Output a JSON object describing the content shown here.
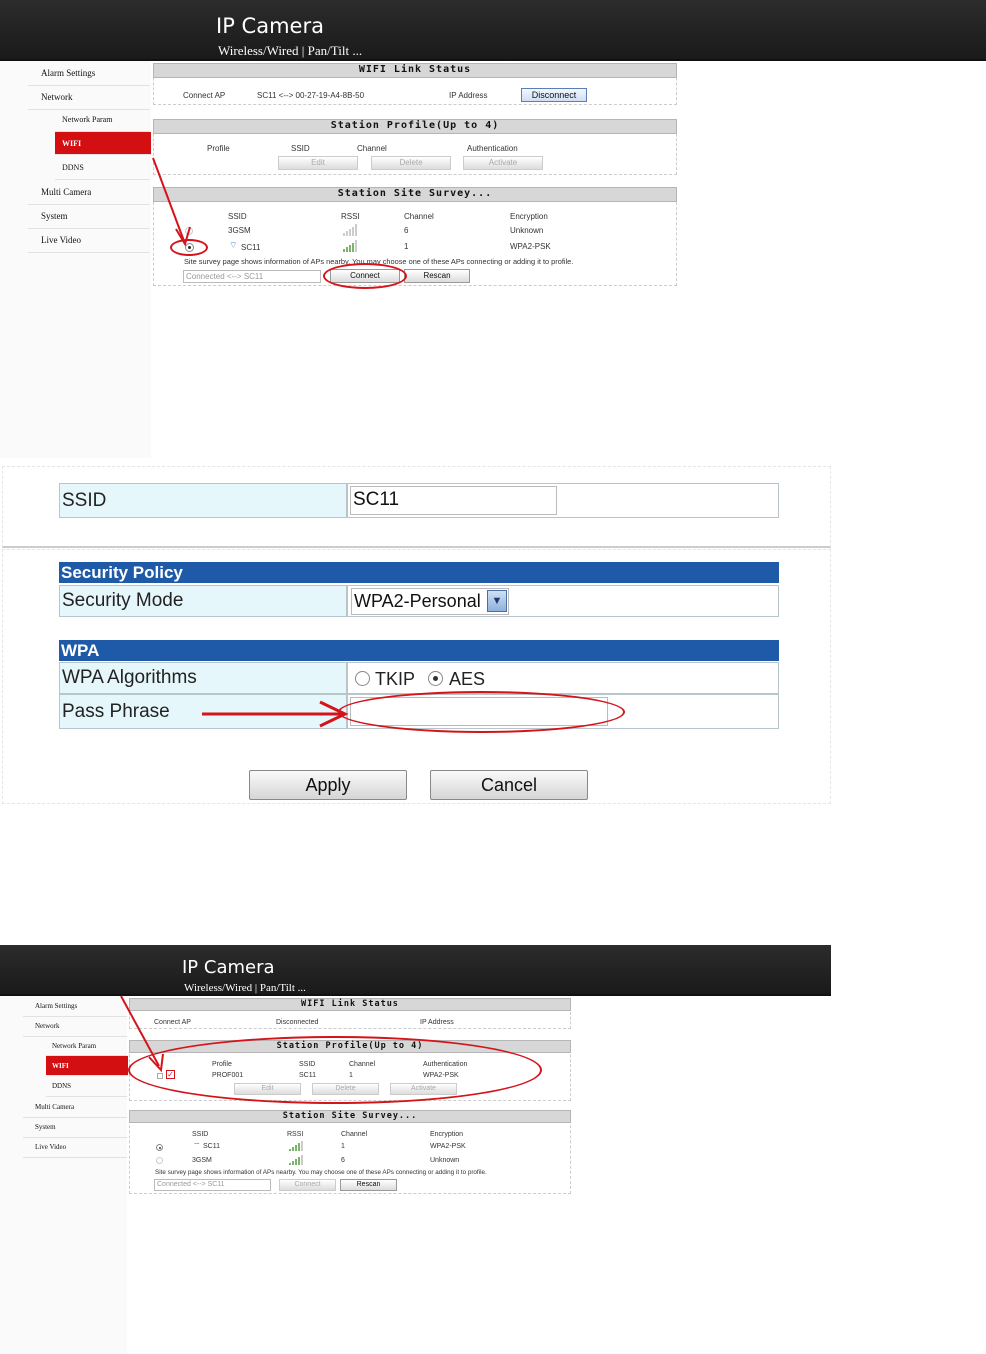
{
  "app": {
    "title": "IP Camera",
    "subtitle": "Wireless/Wired | Pan/Tilt ..."
  },
  "sidebar": {
    "items": [
      "Alarm Settings",
      "Network",
      "Network Param",
      "WIFI",
      "DDNS",
      "Multi Camera",
      "System",
      "Live Video"
    ]
  },
  "shot1": {
    "wifi_status": {
      "header": "WIFI Link Status",
      "connect_ap_label": "Connect AP",
      "connect_ap_value": "SC11 <--> 00-27-19-A4-8B-50",
      "ip_label": "IP Address",
      "disconnect_btn": "Disconnect"
    },
    "profile": {
      "header": "Station Profile(Up to 4)",
      "columns": [
        "Profile",
        "SSID",
        "Channel",
        "Authentication"
      ],
      "buttons": [
        "Edit",
        "Delete",
        "Activate"
      ]
    },
    "survey": {
      "header": "Station Site Survey...",
      "columns": [
        "SSID",
        "RSSI",
        "Channel",
        "Encryption"
      ],
      "rows": [
        {
          "ssid": "3GSM",
          "channel": "6",
          "encryption": "Unknown",
          "selected": false
        },
        {
          "ssid": "SC11",
          "channel": "1",
          "encryption": "WPA2-PSK",
          "selected": true
        }
      ],
      "info": "Site survey page shows information of APs nearby. You may choose one of these APs connecting or adding it to profile.",
      "connected_field": "Connected <--> SC11",
      "connect_btn": "Connect",
      "rescan_btn": "Rescan"
    }
  },
  "form": {
    "ssid_label": "SSID",
    "ssid_value": "SC11",
    "security_policy": "Security Policy",
    "security_mode_label": "Security Mode",
    "security_mode_value": "WPA2-Personal",
    "wpa_header": "WPA",
    "wpa_alg_label": "WPA Algorithms",
    "tkip": "TKIP",
    "aes": "AES",
    "selected_algorithm": "AES",
    "passphrase_label": "Pass Phrase",
    "passphrase_value": "",
    "apply_btn": "Apply",
    "cancel_btn": "Cancel"
  },
  "shot2": {
    "wifi_status": {
      "header": "WIFI Link Status",
      "connect_ap_label": "Connect AP",
      "connect_ap_value": "Disconnected",
      "ip_label": "IP Address"
    },
    "profile": {
      "header": "Station Profile(Up to 4)",
      "columns": [
        "Profile",
        "SSID",
        "Channel",
        "Authentication"
      ],
      "row": {
        "profile": "PROF001",
        "ssid": "SC11",
        "channel": "1",
        "auth": "WPA2-PSK"
      },
      "buttons": [
        "Edit",
        "Delete",
        "Activate"
      ]
    },
    "survey": {
      "header": "Station Site Survey...",
      "columns": [
        "SSID",
        "RSSI",
        "Channel",
        "Encryption"
      ],
      "rows": [
        {
          "ssid": "SC11",
          "channel": "1",
          "encryption": "WPA2-PSK",
          "selected": true
        },
        {
          "ssid": "3GSM",
          "channel": "6",
          "encryption": "Unknown",
          "selected": false
        }
      ],
      "info": "Site survey page shows information of APs nearby. You may choose one of these APs connecting or adding it to profile.",
      "connected_field": "Connected <--> SC11",
      "connect_btn": "Connect",
      "rescan_btn": "Rescan"
    }
  },
  "colors": {
    "accent_red": "#d40f12",
    "security_bar_blue": "#1e5aa8",
    "annotation_red": "#d4141a"
  }
}
